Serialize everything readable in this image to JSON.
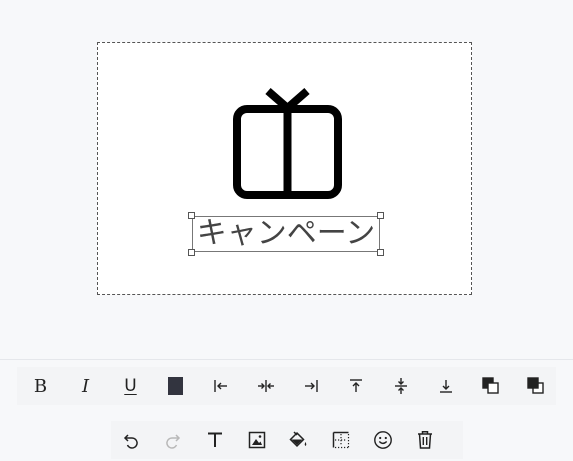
{
  "canvas": {
    "text": "キャンペーン",
    "icon": "gift-icon"
  },
  "format_toolbar": {
    "items": [
      {
        "name": "bold-button",
        "label": "B",
        "icon": "bold-icon"
      },
      {
        "name": "italic-button",
        "label": "I",
        "icon": "italic-icon"
      },
      {
        "name": "underline-button",
        "label": "U",
        "icon": "underline-icon"
      },
      {
        "name": "text-color-button",
        "icon": "color-swatch-icon",
        "color": "#32343f"
      },
      {
        "name": "align-left-button",
        "icon": "align-left-icon"
      },
      {
        "name": "align-center-button",
        "icon": "align-center-icon"
      },
      {
        "name": "align-right-button",
        "icon": "align-right-icon"
      },
      {
        "name": "align-top-button",
        "icon": "align-top-icon"
      },
      {
        "name": "align-middle-button",
        "icon": "align-middle-icon"
      },
      {
        "name": "align-bottom-button",
        "icon": "align-bottom-icon"
      },
      {
        "name": "send-backward-button",
        "icon": "send-backward-icon"
      },
      {
        "name": "bring-forward-button",
        "icon": "bring-forward-icon"
      }
    ]
  },
  "main_toolbar": {
    "items": [
      {
        "name": "undo-button",
        "icon": "undo-icon",
        "enabled": true
      },
      {
        "name": "redo-button",
        "icon": "redo-icon",
        "enabled": false
      },
      {
        "name": "add-text-button",
        "icon": "text-icon",
        "enabled": true
      },
      {
        "name": "add-image-button",
        "icon": "image-icon",
        "enabled": true
      },
      {
        "name": "fill-color-button",
        "icon": "paint-bucket-icon",
        "enabled": true
      },
      {
        "name": "background-pattern-button",
        "icon": "dotted-border-icon",
        "enabled": true
      },
      {
        "name": "add-emoji-button",
        "icon": "emoji-icon",
        "enabled": true
      },
      {
        "name": "delete-button",
        "icon": "trash-icon",
        "enabled": true
      }
    ]
  },
  "colors": {
    "background": "#f7f8fa",
    "toolbar": "#f3f4f6",
    "icon": "#222222",
    "disabled_icon": "#b8b8b8",
    "text_color": "#32343f"
  }
}
